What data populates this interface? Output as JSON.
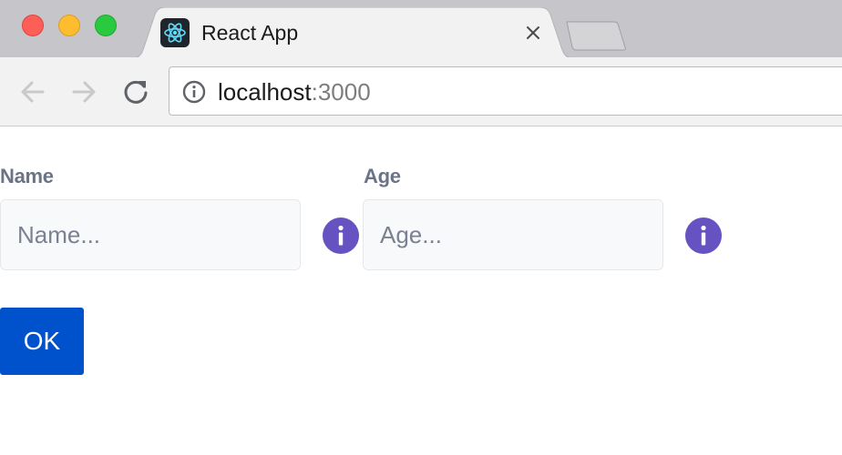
{
  "browser": {
    "tab_title": "React App",
    "address": {
      "host": "localhost",
      "port": ":3000"
    },
    "icons": {
      "favicon": "react-logo-icon",
      "tab_close": "close-icon",
      "back": "arrow-left-icon",
      "forward": "arrow-right-icon",
      "reload": "reload-icon",
      "site_info": "info-circle-icon"
    }
  },
  "form": {
    "name": {
      "label": "Name",
      "placeholder": "Name...",
      "value": "",
      "help_icon": "info-icon"
    },
    "age": {
      "label": "Age",
      "placeholder": "Age...",
      "value": "",
      "help_icon": "info-icon"
    },
    "submit_label": "OK"
  },
  "colors": {
    "label": "#6b7487",
    "info_badge": "#6652c0",
    "primary_button": "#0052cc",
    "input_background": "#f8f9fb"
  }
}
